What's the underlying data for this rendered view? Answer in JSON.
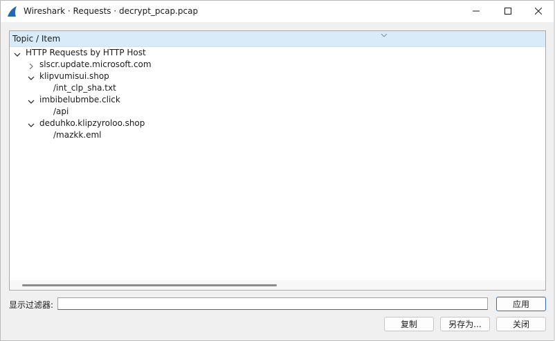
{
  "window": {
    "title": "Wireshark · Requests · decrypt_pcap.pcap"
  },
  "tree": {
    "column_header": "Topic / Item",
    "rows": [
      {
        "label": "HTTP Requests by HTTP Host",
        "level": 0,
        "expander": "expanded"
      },
      {
        "label": "slscr.update.microsoft.com",
        "level": 1,
        "expander": "collapsed"
      },
      {
        "label": "klipvumisui.shop",
        "level": 1,
        "expander": "expanded"
      },
      {
        "label": "/int_clp_sha.txt",
        "level": 2,
        "expander": "none"
      },
      {
        "label": "imbibelubmbe.click",
        "level": 1,
        "expander": "expanded"
      },
      {
        "label": "/api",
        "level": 2,
        "expander": "none"
      },
      {
        "label": "deduhko.klipzyroloo.shop",
        "level": 1,
        "expander": "expanded"
      },
      {
        "label": "/mazkk.eml",
        "level": 2,
        "expander": "none"
      }
    ]
  },
  "filter": {
    "label": "显示过滤器:",
    "value": "",
    "apply_label": "应用"
  },
  "buttons": {
    "copy_label": "复制",
    "save_as_label": "另存为...",
    "close_label": "关闭"
  },
  "colors": {
    "header_bg": "#d9ebf9",
    "window_bg": "#f0f0f0",
    "accent": "#2a6fb9",
    "app_icon": "#1b6bbd"
  },
  "icons": {
    "app": "wireshark-fin-icon",
    "minimize": "minimize-icon",
    "maximize": "maximize-icon",
    "close": "close-icon",
    "expanded": "chevron-down-icon",
    "collapsed": "chevron-right-icon"
  }
}
